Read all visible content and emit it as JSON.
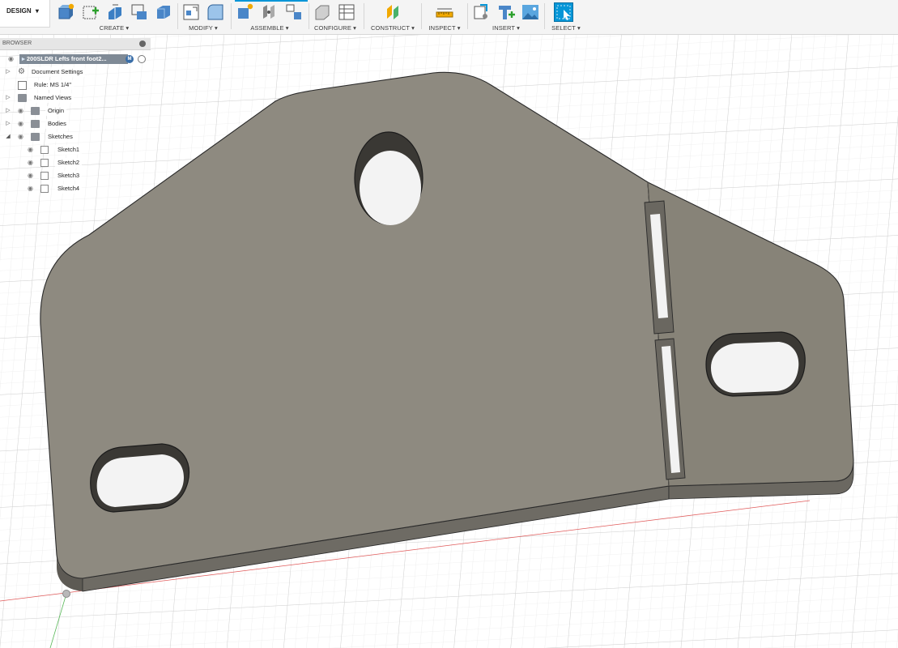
{
  "toolbar": {
    "workspace": "DESIGN",
    "groups": [
      {
        "label": "CREATE"
      },
      {
        "label": "MODIFY"
      },
      {
        "label": "ASSEMBLE"
      },
      {
        "label": "CONFIGURE"
      },
      {
        "label": "CONSTRUCT"
      },
      {
        "label": "INSPECT"
      },
      {
        "label": "INSERT"
      },
      {
        "label": "SELECT"
      }
    ],
    "dropdown_glyph": "▾",
    "accent_color": "#0696d7"
  },
  "browser": {
    "title": "BROWSER",
    "root": {
      "label": "200SLDR Lefts front foot2...",
      "badge": "M"
    },
    "items": [
      {
        "label": "Document Settings",
        "icon": "gear-icon"
      },
      {
        "label": "Rule: MS 1/4\"",
        "icon": "sheet-metal-rule-icon"
      },
      {
        "label": "Named Views",
        "icon": "folder-icon"
      },
      {
        "label": "Origin",
        "icon": "folder-icon"
      },
      {
        "label": "Bodies",
        "icon": "folder-icon"
      },
      {
        "label": "Sketches",
        "icon": "folder-icon"
      }
    ],
    "sketches": [
      {
        "label": "Sketch1"
      },
      {
        "label": "Sketch2"
      },
      {
        "label": "Sketch3"
      },
      {
        "label": "Sketch4"
      }
    ]
  },
  "canvas": {
    "background": "#ffffff",
    "grid_color": "#dcdcdc",
    "part_color": "#8e8a80",
    "part_edge_color": "#2a2a2a"
  }
}
